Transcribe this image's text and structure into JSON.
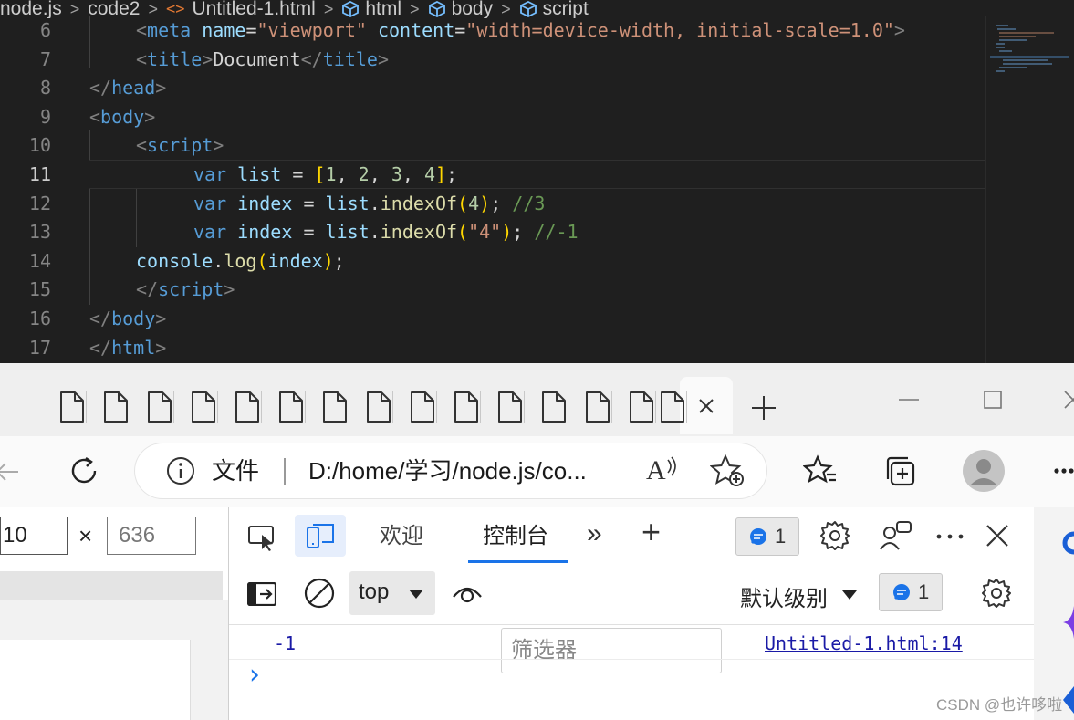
{
  "breadcrumb": {
    "items": [
      "node.js",
      "code2",
      "Untitled-1.html",
      "html",
      "body",
      "script"
    ],
    "separator": ">",
    "html_icon": "<>"
  },
  "editor": {
    "lines": [
      {
        "no": "6"
      },
      {
        "no": "7"
      },
      {
        "no": "8"
      },
      {
        "no": "9"
      },
      {
        "no": "10"
      },
      {
        "no": "11"
      },
      {
        "no": "12"
      },
      {
        "no": "13"
      },
      {
        "no": "14"
      },
      {
        "no": "15"
      },
      {
        "no": "16"
      },
      {
        "no": "17"
      }
    ],
    "tokens": {
      "l6": {
        "meta": "meta",
        "name_attr": "name",
        "eq": "=",
        "viewport": "\"viewport\"",
        "content_attr": "content",
        "content_val": "\"width=device-width, initial-scale=1.0\""
      },
      "l7": {
        "title": "title",
        "text": "Document"
      },
      "l8": {
        "head": "head"
      },
      "l9": {
        "body": "body"
      },
      "l10": {
        "script": "script"
      },
      "l11": {
        "kw": "var",
        "name": "list",
        "op": "=",
        "open": "[",
        "n1": "1",
        "n2": "2",
        "n3": "3",
        "n4": "4",
        "close": "]",
        "semi": ";"
      },
      "l12": {
        "kw": "var",
        "name": "index",
        "op": "=",
        "obj": "list",
        "fn": "indexOf",
        "arg": "4",
        "comment": "//3"
      },
      "l13": {
        "kw": "var",
        "name": "index",
        "op": "=",
        "obj": "list",
        "fn": "indexOf",
        "arg": "\"4\"",
        "comment": "//-1"
      },
      "l14": {
        "obj": "console",
        "fn": "log",
        "arg": "index"
      },
      "l15": {
        "script": "script"
      },
      "l16": {
        "body": "body"
      },
      "l17": {
        "html": "html"
      }
    }
  },
  "browser": {
    "address": {
      "info_label": "文件",
      "url": "D:/home/学习/node.js/co..."
    },
    "read_aloud_label": "A",
    "window_controls": {
      "minimize": "—",
      "maximize": "☐",
      "close": "✕"
    }
  },
  "devtools": {
    "dimensions": {
      "width": "10",
      "times": "×",
      "height": "636"
    },
    "tabs": {
      "welcome": "欢迎",
      "console": "控制台",
      "more": "»",
      "add": "+"
    },
    "issues_count": "1",
    "console_toolbar": {
      "context": "top",
      "filter_placeholder": "筛选器",
      "level": "默认级别",
      "issues_count": "1"
    },
    "log": {
      "value": "-1",
      "source": "Untitled-1.html:14"
    },
    "prompt": "›"
  },
  "watermark": "CSDN @也许哆啦",
  "colors": {
    "editor_bg": "#1f1f1f",
    "tag": "#569cd6",
    "string": "#ce9178",
    "comment": "#6a9955",
    "number": "#b5cea8",
    "function": "#dcdcaa",
    "link": "#1a1aa6",
    "console_accent": "#1a73e8"
  }
}
